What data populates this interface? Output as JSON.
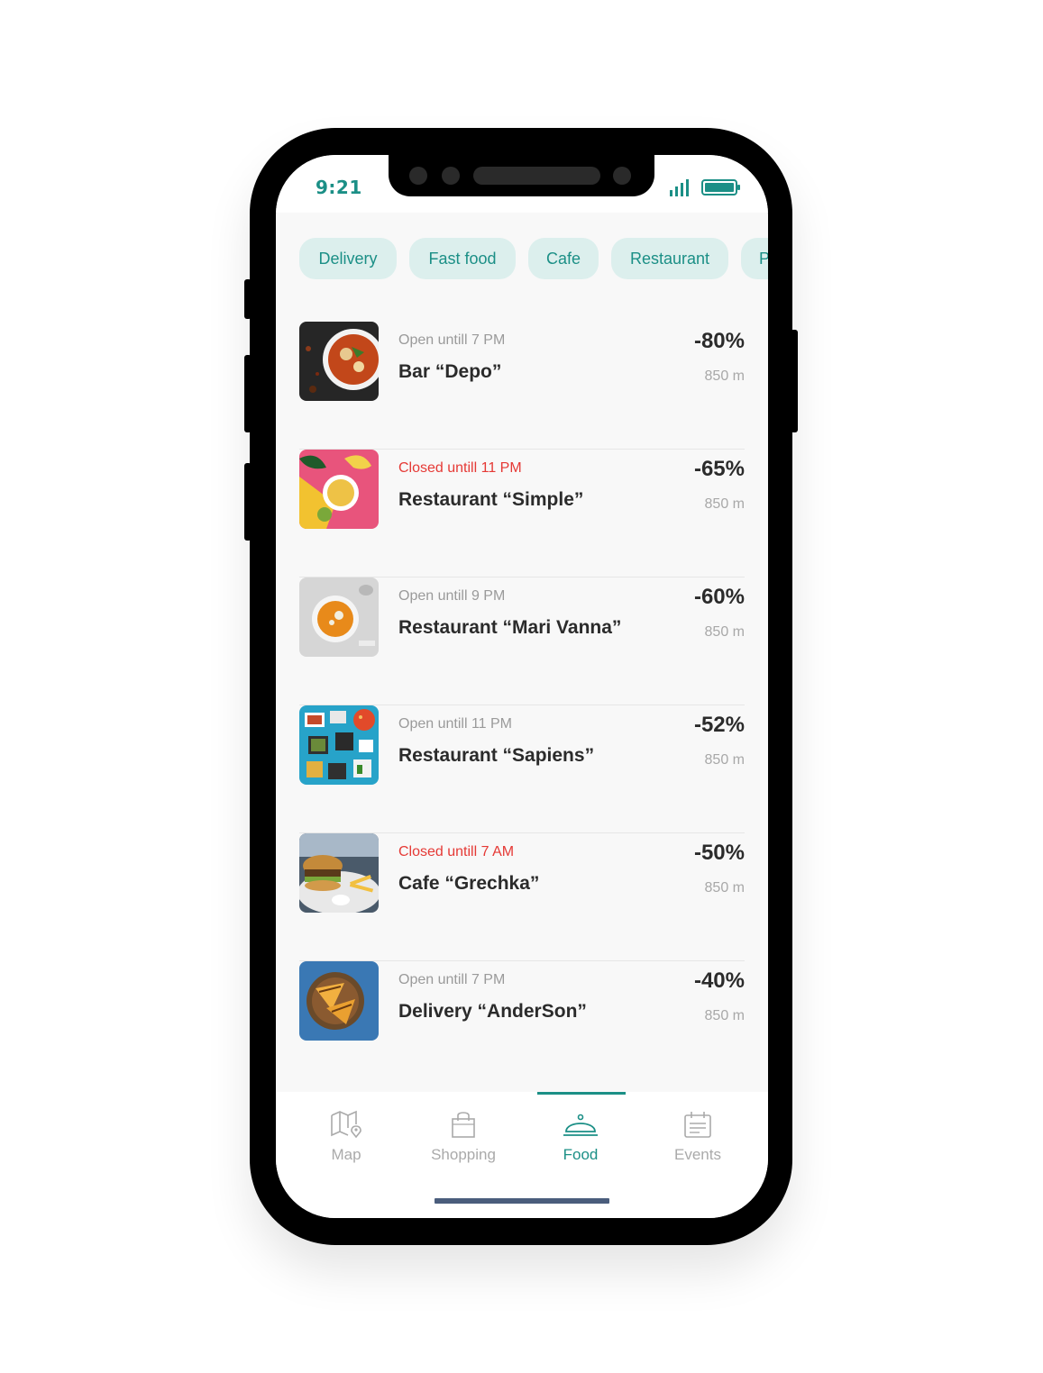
{
  "status_bar": {
    "time": "9:21"
  },
  "categories": [
    "Delivery",
    "Fast food",
    "Cafe",
    "Restaurant",
    "P"
  ],
  "places": [
    {
      "status": "Open untill 7 PM",
      "status_state": "open",
      "name": "Bar “Depo”",
      "discount": "-80%",
      "distance": "850 m",
      "image": "soup-bowl"
    },
    {
      "status": "Closed untill 11 PM",
      "status_state": "closed",
      "name": "Restaurant “Simple”",
      "discount": "-65%",
      "distance": "850 m",
      "image": "yellow-soup-banana"
    },
    {
      "status": "Open untill 9 PM",
      "status_state": "open",
      "name": "Restaurant “Mari Vanna”",
      "discount": "-60%",
      "distance": "850 m",
      "image": "pumpkin-soup"
    },
    {
      "status": "Open untill 11 PM",
      "status_state": "open",
      "name": "Restaurant “Sapiens”",
      "discount": "-52%",
      "distance": "850 m",
      "image": "lunch-boxes"
    },
    {
      "status": "Closed untill 7 AM",
      "status_state": "closed",
      "name": "Cafe “Grechka”",
      "discount": "-50%",
      "distance": "850 m",
      "image": "burger-fries"
    },
    {
      "status": "Open untill 7 PM",
      "status_state": "open",
      "name": "Delivery “AnderSon”",
      "discount": "-40%",
      "distance": "850 m",
      "image": "sandwiches"
    }
  ],
  "tabs": [
    {
      "label": "Map",
      "icon": "map-icon"
    },
    {
      "label": "Shopping",
      "icon": "shopping-bag-icon"
    },
    {
      "label": "Food",
      "icon": "cloche-icon",
      "active": true
    },
    {
      "label": "Events",
      "icon": "calendar-icon"
    }
  ],
  "colors": {
    "accent": "#1b8f86",
    "closed": "#e53935",
    "chip_bg": "#dcefed"
  }
}
